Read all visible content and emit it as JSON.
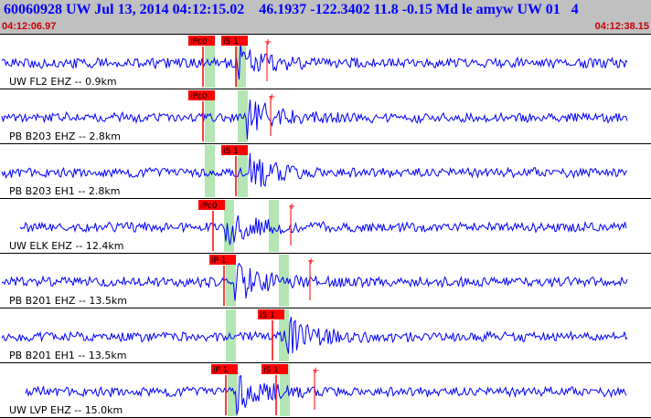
{
  "header": {
    "title": "60060928 UW Jul 13, 2014 04:12:15.02    46.1937 -122.3402 11.8 -0.15 Md le amyw UW 01   4",
    "time_start": "04:12:06.97",
    "time_end": "04:12:38.15"
  },
  "colors": {
    "header_bg": "#c0c0c0",
    "title": "#0000ff",
    "timestamp": "#cc0000",
    "waveform": "#0000ff",
    "pick_marker": "#ff0000",
    "pick_window": "#b4e6b4",
    "separator": "#000000"
  },
  "traces": [
    {
      "label": "UW FL2 EHZ -- 0.9km",
      "picks": [
        {
          "text": "iPc0"
        },
        {
          "text": "iS 1"
        }
      ]
    },
    {
      "label": "PB B203 EHZ -- 2.8km",
      "picks": [
        {
          "text": "iPc0"
        }
      ]
    },
    {
      "label": "PB B203 EH1 -- 2.8km",
      "picks": [
        {
          "text": "iS 1"
        }
      ]
    },
    {
      "label": "UW ELK EHZ -- 12.4km",
      "picks": [
        {
          "text": "iPc0"
        }
      ]
    },
    {
      "label": "PB B201 EHZ -- 13.5km",
      "picks": [
        {
          "text": "iP 1"
        }
      ]
    },
    {
      "label": "PB B201 EH1 -- 13.5km",
      "picks": [
        {
          "text": "iS 1"
        }
      ]
    },
    {
      "label": "UW LVP EHZ -- 15.0km",
      "picks": [
        {
          "text": "iP 1"
        },
        {
          "text": "iS 1"
        }
      ]
    }
  ]
}
